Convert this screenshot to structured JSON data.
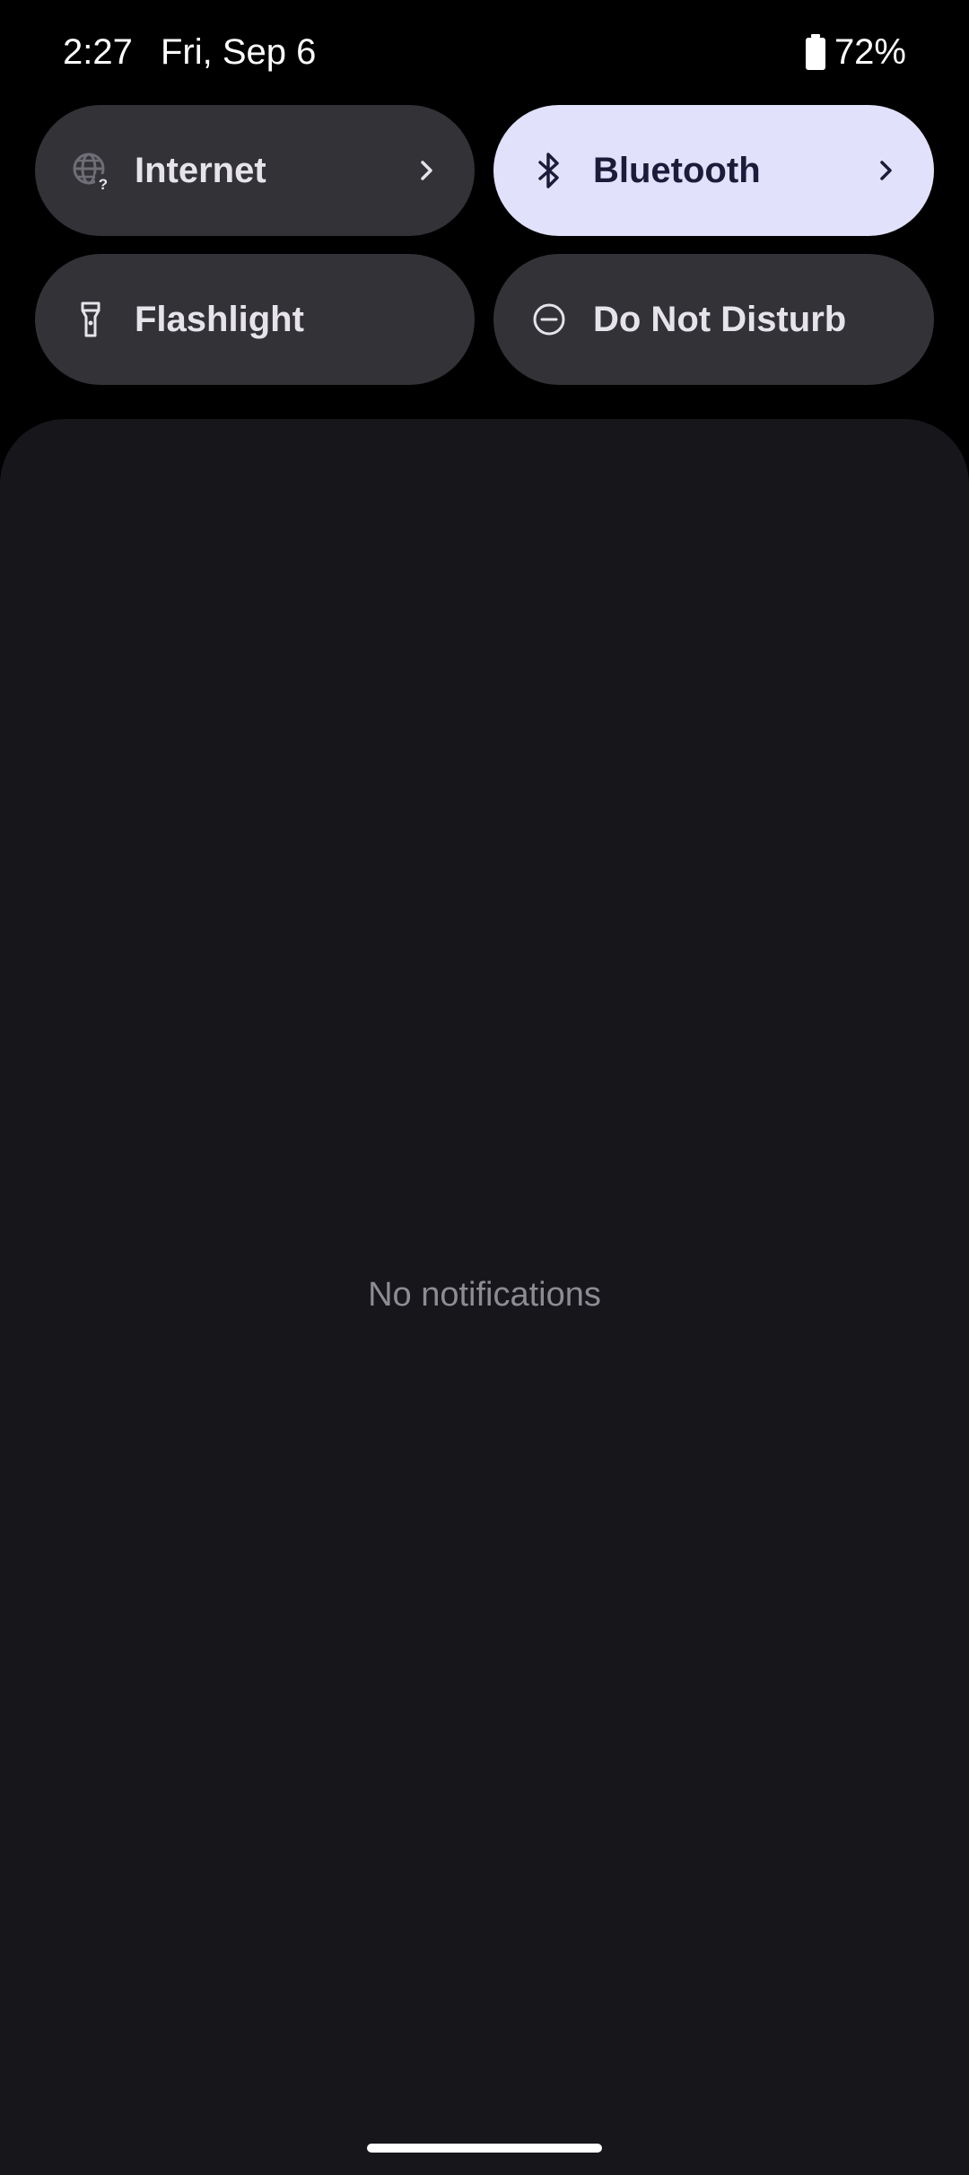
{
  "status_bar": {
    "time": "2:27",
    "date": "Fri, Sep 6",
    "battery_percent": "72%",
    "battery_icon": "battery-icon"
  },
  "quick_settings": {
    "tiles": [
      {
        "label": "Internet",
        "icon": "globe-question-icon",
        "active": false,
        "has_chevron": true
      },
      {
        "label": "Bluetooth",
        "icon": "bluetooth-icon",
        "active": true,
        "has_chevron": true
      },
      {
        "label": "Flashlight",
        "icon": "flashlight-icon",
        "active": false,
        "has_chevron": false
      },
      {
        "label": "Do Not Disturb",
        "icon": "do-not-disturb-icon",
        "active": false,
        "has_chevron": false
      }
    ]
  },
  "notifications": {
    "empty_text": "No notifications"
  },
  "colors": {
    "background": "#000000",
    "tile_inactive": "#323237",
    "tile_active": "#e1e1fc",
    "panel": "#16161b"
  }
}
